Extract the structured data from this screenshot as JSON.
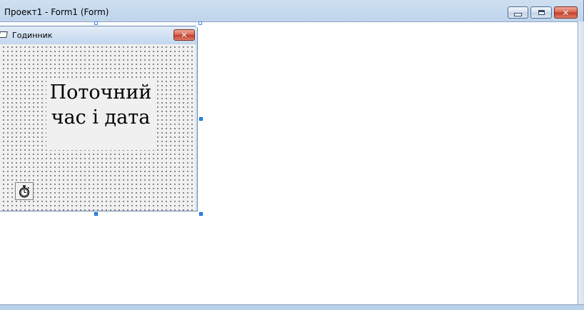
{
  "window": {
    "title": "Проект1 - Form1 (Form)",
    "buttons": {
      "minimize": "minimize-icon",
      "maximize": "maximize-icon",
      "close": "close-icon"
    }
  },
  "form": {
    "caption": "Годинник",
    "label_caption": "Поточний\nчас і дата",
    "timer_icon": "stopwatch-icon"
  },
  "colors": {
    "frame": "#b9d1ea",
    "client": "#ffffff",
    "form_background": "#f0f0f0",
    "close_button": "#c4392a",
    "selection_handle": "#1e90ff"
  }
}
